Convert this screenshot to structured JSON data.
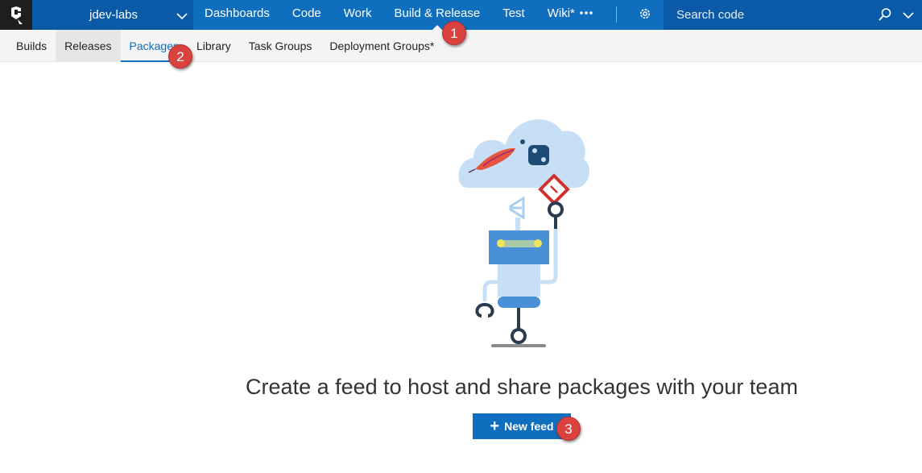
{
  "topbar": {
    "project_name": "jdev-labs",
    "nav": [
      {
        "label": "Dashboards"
      },
      {
        "label": "Code"
      },
      {
        "label": "Work"
      },
      {
        "label": "Build & Release"
      },
      {
        "label": "Test"
      },
      {
        "label": "Wiki*"
      }
    ],
    "active_nav": "Build & Release",
    "search_placeholder": "Search code"
  },
  "subnav": {
    "items": [
      {
        "label": "Builds"
      },
      {
        "label": "Releases"
      },
      {
        "label": "Packages"
      },
      {
        "label": "Library"
      },
      {
        "label": "Task Groups"
      },
      {
        "label": "Deployment Groups*"
      }
    ],
    "active": "Packages",
    "hovered": "Releases"
  },
  "callouts": {
    "one": "1",
    "two": "2",
    "three": "3"
  },
  "main": {
    "headline": "Create a feed to host and share packages with your team",
    "new_feed_label": "New feed"
  },
  "colors": {
    "brand_blue": "#106ebe",
    "callout_red": "#d9423e"
  },
  "icons": {
    "logo": "vsts-logo-icon",
    "project_chevron": "chevron-down-icon",
    "more": "ellipsis-icon",
    "settings": "gear-icon",
    "search": "search-icon",
    "plus": "plus-icon"
  }
}
